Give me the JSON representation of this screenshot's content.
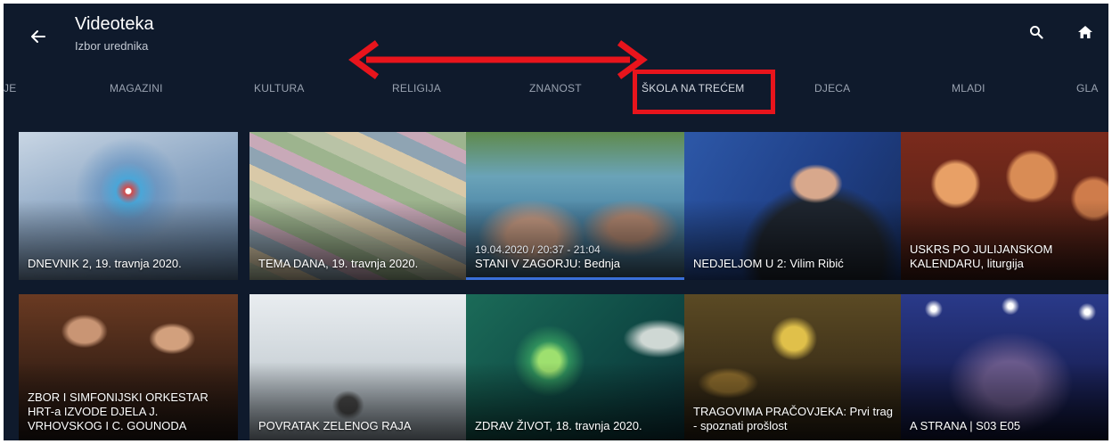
{
  "header": {
    "title": "Videoteka",
    "subtitle": "Izbor urednika",
    "icons": {
      "back": "arrow-left",
      "search": "search",
      "home": "home"
    }
  },
  "tabs": [
    {
      "label": "JE",
      "selected": false
    },
    {
      "label": "MAGAZINI",
      "selected": false
    },
    {
      "label": "KULTURA",
      "selected": false
    },
    {
      "label": "RELIGIJA",
      "selected": false
    },
    {
      "label": "ZNANOST",
      "selected": false
    },
    {
      "label": "ŠKOLA NA TREĆEM",
      "selected": true
    },
    {
      "label": "DJECA",
      "selected": false
    },
    {
      "label": "MLADI",
      "selected": false
    },
    {
      "label": "GLA",
      "selected": false
    }
  ],
  "cards": [
    {
      "title": "DNEVNIK 2, 19. travnja 2020."
    },
    {
      "title": "TEMA DANA, 19. travnja 2020."
    },
    {
      "meta": "19.04.2020 / 20:37 - 21:04",
      "title": "STANI V ZAGORJU: Bednja",
      "focused": true
    },
    {
      "title": "NEDJELJOM U 2: Vilim Ribić"
    },
    {
      "title": "USKRS PO JULIJANSKOM KALENDARU, liturgija"
    },
    {
      "title": "ZBOR I SIMFONIJSKI ORKESTAR HRT-a IZVODE DJELA J. VRHOVSKOG I C. GOUNODA"
    },
    {
      "title": "POVRATAK ZELENOG RAJA"
    },
    {
      "title": "ZDRAV ŽIVOT, 18. travnja 2020."
    },
    {
      "title": "TRAGOVIMA PRAČOVJEKA: Prvi trag - spoznati prošlost"
    },
    {
      "title": "A STRANA | S03 E05"
    }
  ],
  "colors": {
    "background": "#0f1a2c",
    "annotation": "#e8141c",
    "focus_underline": "#3a6fd8"
  }
}
